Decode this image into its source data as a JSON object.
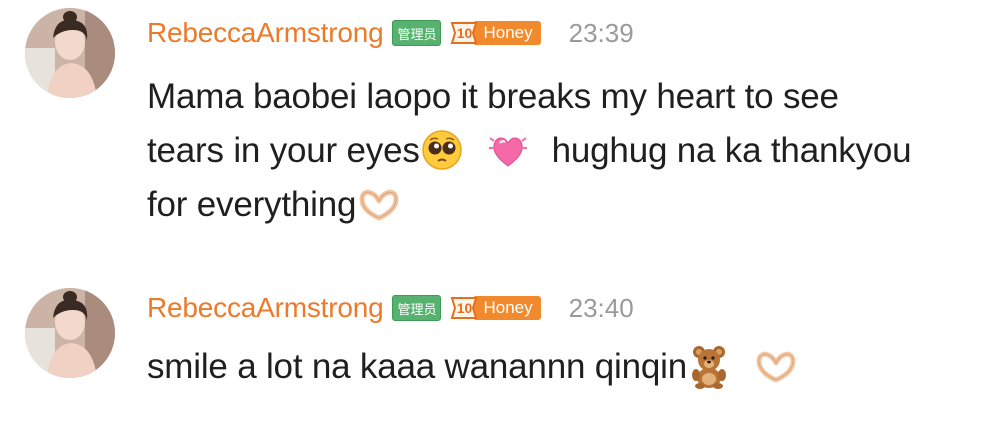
{
  "messages": [
    {
      "username": "RebeccaArmstrong",
      "admin_badge": "管理员",
      "fan_level": "10",
      "fan_badge_name": "Honey",
      "time": "23:39",
      "text_line1": "Mama baobei laopo it breaks my heart to see",
      "text_line2a": "tears in your eyes",
      "text_line2b": "hughug na ka thankyou",
      "text_line3": "for everything",
      "emojis": [
        "pleading-face-emoji",
        "growing-heart-emoji",
        "heart-hands-emoji"
      ]
    },
    {
      "username": "RebeccaArmstrong",
      "admin_badge": "管理员",
      "fan_level": "10",
      "fan_badge_name": "Honey",
      "time": "23:40",
      "text": "smile a lot na kaaa wanannn qinqin",
      "emojis": [
        "teddy-bear-emoji",
        "heart-hands-emoji"
      ]
    }
  ],
  "colors": {
    "username": "#ec7a2b",
    "admin_badge_bg": "#56b26e",
    "fan_badge_bg": "#f08a2d",
    "time": "#9a9a9a",
    "text": "#1f1f1f"
  }
}
